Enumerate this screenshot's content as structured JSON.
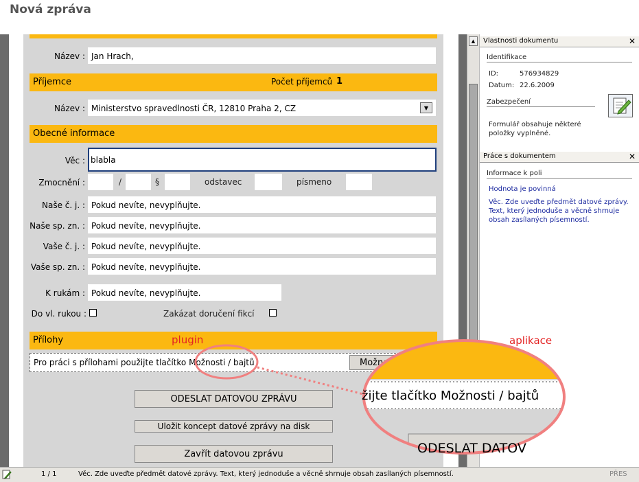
{
  "page_title": "Nová zpráva",
  "form": {
    "name_label": "Název :",
    "name_value": "Jan Hrach,",
    "recipient_section": "Příjemce",
    "recipient_count_label": "Počet příjemců",
    "recipient_count": "1",
    "recipient_name_label": "Název :",
    "recipient_name_value": "Ministerstvo spravedlnosti ČR, 12810 Praha 2, CZ",
    "general_section": "Obecné informace",
    "subject_label": "Věc :",
    "subject_value": "blabla",
    "authorization_label": "Zmocnění :",
    "slash": "/",
    "paragraph_sign": "§",
    "odstavec_label": "odstavec",
    "pismeno_label": "písmeno",
    "our_ref_label": "Naše č. j. :",
    "our_file_label": "Naše sp. zn. :",
    "your_ref_label": "Vaše č. j. :",
    "your_file_label": "Vaše sp. zn. :",
    "attention_label": "K rukám :",
    "placeholder_text": "Pokud nevíte, nevyplňujte.",
    "personal_delivery_label": "Do vl. rukou :",
    "no_fiction_label": "Zakázat doručení fikcí",
    "attachments_section": "Přílohy",
    "attachments_info": "Pro práci s přílohami použijte tlačítko Možnosti / bajtů",
    "options_button": "Možno"
  },
  "buttons": {
    "send": "ODESLAT DATOVOU ZPRÁVU",
    "save_draft": "Uložit koncept datové zprávy na disk",
    "close": "Zavřít datovou zprávu"
  },
  "right_panel": {
    "props_title": "Vlastnosti dokumentu",
    "identification": "Identifikace",
    "id_label": "ID:",
    "id_value": "576934829",
    "date_label": "Datum:",
    "date_value": "22.6.2009",
    "security": "Zabezpečení",
    "security_text": "Formulář obsahuje některé položky vyplněné.",
    "work_title": "Práce s dokumentem",
    "field_info": "Informace k poli",
    "required": "Hodnota je povinná",
    "help_text": "Věc. Zde uveďte předmět datové zprávy. Text, který jednoduše a věcně shrnuje obsah zasílaných písemností."
  },
  "status_bar": {
    "page": "1 / 1",
    "message": "Věc. Zde uveďte předmět datové zprávy.  Text, který jednoduše a věcně shrnuje obsah zasílaných písemností.",
    "mode": "PŘES"
  },
  "annotations": {
    "plugin": "plugin",
    "aplikace": "aplikace",
    "zoom_text": "žijte tlačítko Možnosti / bajtů",
    "zoom_button": "ODESLAT DATOV"
  },
  "colors": {
    "accent_orange": "#fbb811",
    "annotation_red": "#e42323",
    "focus_border": "#1f3f7c"
  }
}
